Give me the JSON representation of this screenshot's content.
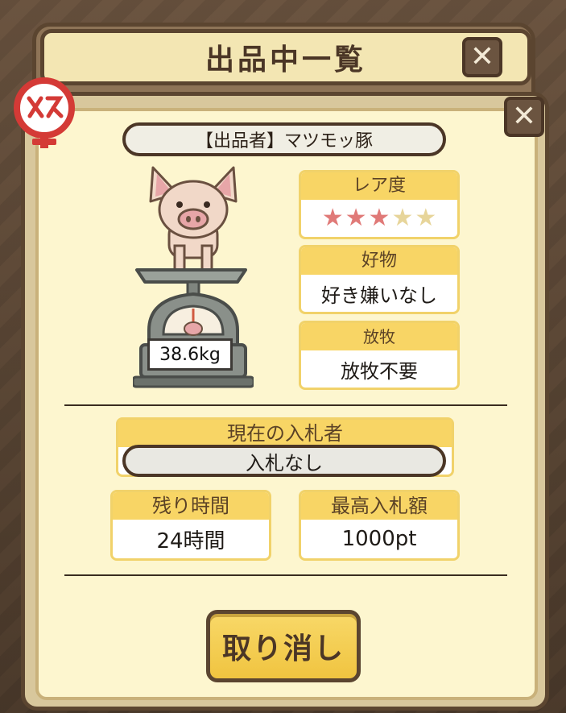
{
  "header": {
    "title": "出品中一覧"
  },
  "seller": {
    "label": "【出品者】マツモッ豚"
  },
  "pig": {
    "weight": "38.6kg"
  },
  "rarity": {
    "label": "レア度",
    "stars_filled": 3,
    "stars_total": 5,
    "star_symbol": "★",
    "filled_color": "#e07a78",
    "empty_color": "#e7d59a"
  },
  "favorite": {
    "label": "好物",
    "value": "好き嫌いなし"
  },
  "pasture": {
    "label": "放牧",
    "value": "放牧不要"
  },
  "bidder": {
    "label": "現在の入札者",
    "value": "入札なし"
  },
  "time_left": {
    "label": "残り時間",
    "value": "24時間"
  },
  "highest_bid": {
    "label": "最高入札額",
    "value": "1000pt"
  },
  "actions": {
    "cancel_label": "取り消し"
  },
  "icons": {
    "close": "close-icon",
    "female": "female-icon",
    "close_glyph": "✕"
  }
}
